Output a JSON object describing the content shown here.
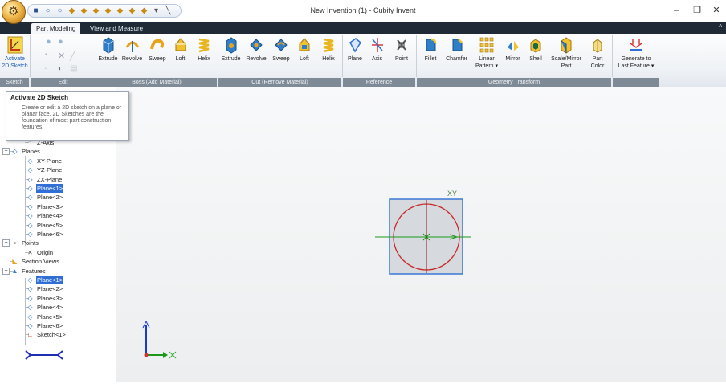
{
  "window": {
    "title": "New Invention (1) - Cubify Invent",
    "controls": [
      "–",
      "❐",
      "✕"
    ]
  },
  "quick_access": [
    "■",
    "○",
    "○",
    "◆",
    "◆",
    "◆",
    "◆",
    "◆",
    "◆",
    "◆",
    "▾",
    "╲"
  ],
  "tabs": [
    {
      "label": "Part Modeling",
      "active": true
    },
    {
      "label": "View and Measure",
      "active": false
    }
  ],
  "ribbon": {
    "groups": [
      {
        "label": "Sketch",
        "buttons": [
          "Activate 2D Sketch"
        ]
      },
      {
        "label": "Edit",
        "buttons": []
      },
      {
        "label": "Boss (Add Material)",
        "buttons": [
          "Extrude",
          "Revolve",
          "Sweep",
          "Loft",
          "Helix"
        ]
      },
      {
        "label": "Cut (Remove Material)",
        "buttons": [
          "Extrude",
          "Revolve",
          "Sweep",
          "Loft",
          "Helix"
        ]
      },
      {
        "label": "Reference",
        "buttons": [
          "Plane",
          "Axis",
          "Point"
        ]
      },
      {
        "label": "Geometry Transform",
        "buttons": [
          "Fillet",
          "Chamfer",
          "Linear Pattern",
          "Mirror",
          "Shell",
          "Scale/Mirror Part",
          "Part Color"
        ]
      },
      {
        "label": "",
        "buttons": [
          "Generate to Last Feature"
        ]
      }
    ],
    "activate_line1": "Activate",
    "activate_line2": "2D Sketch",
    "linear_l1": "Linear",
    "linear_l2": "Pattern ▾",
    "scale_l1": "Scale/Mirror",
    "scale_l2": "Part",
    "color_l1": "Part",
    "color_l2": "Color",
    "generate_l1": "Generate to",
    "generate_l2": "Last Feature ▾"
  },
  "tooltip": {
    "title": "Activate 2D Sketch",
    "body": "Create or edit a 2D sketch on a plane or planar face. 2D Sketches are the foundation of most part construction features."
  },
  "tree": [
    {
      "label": "Z-Axis",
      "icon": "axis-icon",
      "level": 2
    },
    {
      "label": "Planes",
      "icon": "planes-folder-icon",
      "level": 1,
      "expander": "−"
    },
    {
      "label": "XY-Plane",
      "icon": "plane-icon",
      "level": 2
    },
    {
      "label": "YZ-Plane",
      "icon": "plane-icon",
      "level": 2
    },
    {
      "label": "ZX-Plane",
      "icon": "plane-icon",
      "level": 2
    },
    {
      "label": "Plane<1>",
      "icon": "plane-icon",
      "level": 2,
      "selected": true
    },
    {
      "label": "Plane<2>",
      "icon": "plane-icon",
      "level": 2
    },
    {
      "label": "Plane<3>",
      "icon": "plane-icon",
      "level": 2
    },
    {
      "label": "Plane<4>",
      "icon": "plane-icon",
      "level": 2
    },
    {
      "label": "Plane<5>",
      "icon": "plane-icon",
      "level": 2
    },
    {
      "label": "Plane<6>",
      "icon": "plane-icon",
      "level": 2
    },
    {
      "label": "Points",
      "icon": "points-folder-icon",
      "level": 1,
      "expander": "−"
    },
    {
      "label": "Origin",
      "icon": "origin-icon",
      "level": 2
    },
    {
      "label": "Section Views",
      "icon": "section-views-icon",
      "level": 1
    },
    {
      "label": "Features",
      "icon": "features-folder-icon",
      "level": 1,
      "expander": "−"
    },
    {
      "label": "Plane<1>",
      "icon": "plane-icon",
      "level": 2,
      "selected": true
    },
    {
      "label": "Plane<2>",
      "icon": "plane-icon",
      "level": 2
    },
    {
      "label": "Plane<3>",
      "icon": "plane-icon",
      "level": 2
    },
    {
      "label": "Plane<4>",
      "icon": "plane-icon",
      "level": 2
    },
    {
      "label": "Plane<5>",
      "icon": "plane-icon",
      "level": 2
    },
    {
      "label": "Plane<6>",
      "icon": "plane-icon",
      "level": 2
    },
    {
      "label": "Sketch<1>",
      "icon": "sketch-icon",
      "level": 2
    }
  ],
  "canvas": {
    "sketch_label": "XY",
    "colors": {
      "plane_border": "#3a78d8",
      "plane_fill": "#d6d9dd",
      "circle": "#c8282a",
      "axis_x": "#1a9a1a",
      "axis_y": "#1a3ad8"
    }
  }
}
